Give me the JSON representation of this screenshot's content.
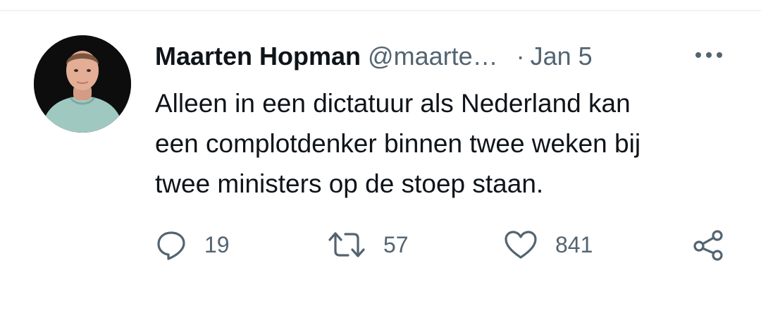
{
  "tweet": {
    "author_name": "Maarten Hopman",
    "handle": "@maarte…",
    "separator": "·",
    "date": "Jan 5",
    "text": "Alleen in een dictatuur als Nederland kan\neen complotdenker binnen twee weken bij\ntwee ministers op de stoep staan.",
    "avatar_icon": "profile-photo",
    "more_icon": "more-dots-icon"
  },
  "actions": {
    "reply": {
      "icon": "reply-icon",
      "count": "19"
    },
    "retweet": {
      "icon": "retweet-icon",
      "count": "57"
    },
    "like": {
      "icon": "heart-icon",
      "count": "841"
    },
    "share": {
      "icon": "share-icon"
    }
  },
  "colors": {
    "text": "#0f1419",
    "secondary": "#536471",
    "divider": "#eff3f4"
  }
}
